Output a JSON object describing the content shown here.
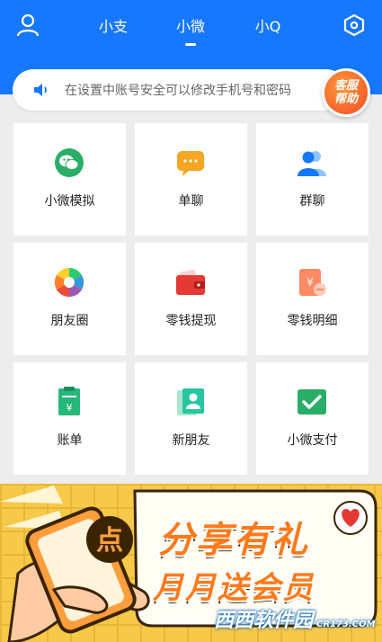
{
  "header": {
    "tabs": [
      {
        "label": "小支",
        "active": false
      },
      {
        "label": "小微",
        "active": true
      },
      {
        "label": "小Q",
        "active": false
      }
    ],
    "accent_color": "#1677ff"
  },
  "notice": {
    "text": "在设置中账号安全可以修改手机号和密码"
  },
  "help_badge": {
    "line1": "客服",
    "line2": "帮助"
  },
  "grid": {
    "items": [
      {
        "label": "小微模拟",
        "icon": "wechat-icon"
      },
      {
        "label": "单聊",
        "icon": "chat-bubble-icon"
      },
      {
        "label": "群聊",
        "icon": "group-users-icon"
      },
      {
        "label": "朋友圈",
        "icon": "aperture-icon"
      },
      {
        "label": "零钱提现",
        "icon": "wallet-icon"
      },
      {
        "label": "零钱明细",
        "icon": "receipt-yuan-icon"
      },
      {
        "label": "账单",
        "icon": "bill-icon"
      },
      {
        "label": "新朋友",
        "icon": "contact-card-icon"
      },
      {
        "label": "小微支付",
        "icon": "pay-check-icon"
      }
    ]
  },
  "banner": {
    "phone_char": "点",
    "line1": "分享有礼",
    "line2": "月月送会员",
    "watermark": "西西软件园",
    "watermark_small": "CR173.COM"
  }
}
